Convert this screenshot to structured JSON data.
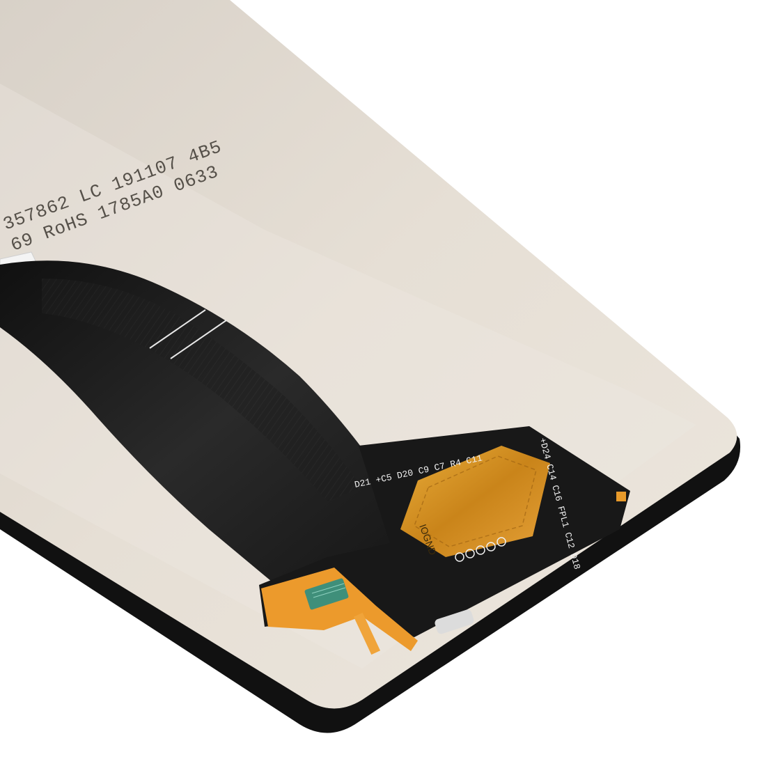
{
  "product": {
    "label_line_1": "357862 LC 191107 4B5",
    "label_line_2": "69 RoHS 1785A0 0633"
  },
  "flex_board": {
    "connector_label": "IOGND",
    "markings_left": "D21 +C5 D20 C9 C7 R4 C11",
    "markings_right": "+D24 C14 C16 FPL1 C12 D18"
  },
  "colors": {
    "background": "#ffffff",
    "panel_back": "#e3dbd0",
    "panel_edge": "#111111",
    "flex_cable": "#1c1c1c",
    "flex_stiffener": "#e89a2a",
    "chip_green": "#3f8f7a"
  }
}
